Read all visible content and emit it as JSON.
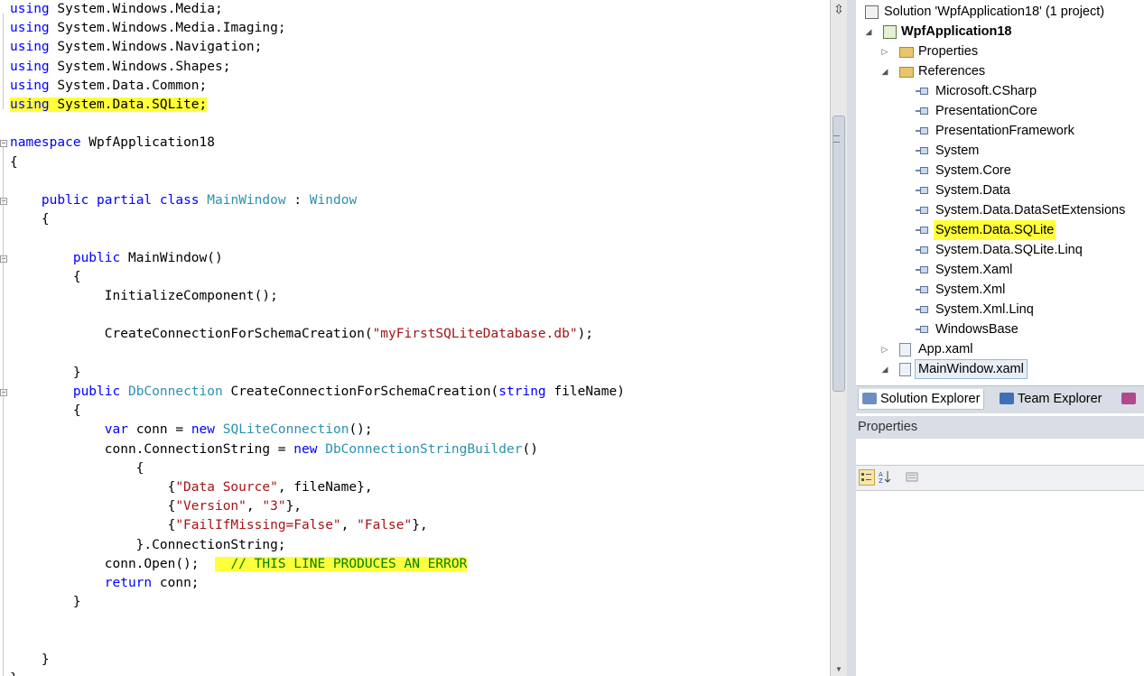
{
  "editor": {
    "lines": [
      {
        "tokens": [
          {
            "t": "using",
            "c": "kw"
          },
          {
            "t": " System.Windows.Media;"
          }
        ]
      },
      {
        "tokens": [
          {
            "t": "using",
            "c": "kw"
          },
          {
            "t": " System.Windows.Media.Imaging;"
          }
        ]
      },
      {
        "tokens": [
          {
            "t": "using",
            "c": "kw"
          },
          {
            "t": " System.Windows.Navigation;"
          }
        ]
      },
      {
        "tokens": [
          {
            "t": "using",
            "c": "kw"
          },
          {
            "t": " System.Windows.Shapes;"
          }
        ]
      },
      {
        "tokens": [
          {
            "t": "using",
            "c": "kw"
          },
          {
            "t": " System.Data.Common;"
          }
        ]
      },
      {
        "tokens": [
          {
            "t": "using",
            "c": "kw hl"
          },
          {
            "t": " System.Data.SQLite;",
            "c": "hl"
          }
        ]
      },
      {
        "tokens": []
      },
      {
        "tokens": [
          {
            "t": "namespace",
            "c": "kw"
          },
          {
            "t": " WpfApplication18"
          }
        ]
      },
      {
        "tokens": [
          {
            "t": "{"
          }
        ]
      },
      {
        "tokens": []
      },
      {
        "tokens": [
          {
            "t": "    "
          },
          {
            "t": "public",
            "c": "kw"
          },
          {
            "t": " "
          },
          {
            "t": "partial",
            "c": "kw"
          },
          {
            "t": " "
          },
          {
            "t": "class",
            "c": "kw"
          },
          {
            "t": " "
          },
          {
            "t": "MainWindow",
            "c": "ty"
          },
          {
            "t": " : "
          },
          {
            "t": "Window",
            "c": "ty"
          }
        ]
      },
      {
        "tokens": [
          {
            "t": "    {"
          }
        ]
      },
      {
        "tokens": []
      },
      {
        "tokens": [
          {
            "t": "        "
          },
          {
            "t": "public",
            "c": "kw"
          },
          {
            "t": " MainWindow()"
          }
        ]
      },
      {
        "tokens": [
          {
            "t": "        {"
          }
        ]
      },
      {
        "tokens": [
          {
            "t": "            InitializeComponent();"
          }
        ]
      },
      {
        "tokens": []
      },
      {
        "tokens": [
          {
            "t": "            CreateConnectionForSchemaCreation("
          },
          {
            "t": "\"myFirstSQLiteDatabase.db\"",
            "c": "str"
          },
          {
            "t": ");"
          }
        ]
      },
      {
        "tokens": []
      },
      {
        "tokens": [
          {
            "t": "        }"
          }
        ]
      },
      {
        "tokens": [
          {
            "t": "        "
          },
          {
            "t": "public",
            "c": "kw"
          },
          {
            "t": " "
          },
          {
            "t": "DbConnection",
            "c": "ty"
          },
          {
            "t": " CreateConnectionForSchemaCreation("
          },
          {
            "t": "string",
            "c": "kw"
          },
          {
            "t": " fileName)"
          }
        ]
      },
      {
        "tokens": [
          {
            "t": "        {"
          }
        ]
      },
      {
        "tokens": [
          {
            "t": "            "
          },
          {
            "t": "var",
            "c": "kw"
          },
          {
            "t": " conn = "
          },
          {
            "t": "new",
            "c": "kw"
          },
          {
            "t": " "
          },
          {
            "t": "SQLiteConnection",
            "c": "ty"
          },
          {
            "t": "();"
          }
        ]
      },
      {
        "tokens": [
          {
            "t": "            conn.ConnectionString = "
          },
          {
            "t": "new",
            "c": "kw"
          },
          {
            "t": " "
          },
          {
            "t": "DbConnectionStringBuilder",
            "c": "ty"
          },
          {
            "t": "()"
          }
        ]
      },
      {
        "tokens": [
          {
            "t": "                {"
          }
        ]
      },
      {
        "tokens": [
          {
            "t": "                    {"
          },
          {
            "t": "\"Data Source\"",
            "c": "str"
          },
          {
            "t": ", fileName},"
          }
        ]
      },
      {
        "tokens": [
          {
            "t": "                    {"
          },
          {
            "t": "\"Version\"",
            "c": "str"
          },
          {
            "t": ", "
          },
          {
            "t": "\"3\"",
            "c": "str"
          },
          {
            "t": "},"
          }
        ]
      },
      {
        "tokens": [
          {
            "t": "                    {"
          },
          {
            "t": "\"FailIfMissing=False\"",
            "c": "str"
          },
          {
            "t": ", "
          },
          {
            "t": "\"False\"",
            "c": "str"
          },
          {
            "t": "},"
          }
        ]
      },
      {
        "tokens": [
          {
            "t": "                }.ConnectionString;"
          }
        ]
      },
      {
        "tokens": [
          {
            "t": "            conn.Open();  "
          },
          {
            "t": "  // THIS LINE PRODUCES AN ERROR",
            "c": "cm hl"
          }
        ]
      },
      {
        "tokens": [
          {
            "t": "            "
          },
          {
            "t": "return",
            "c": "kw"
          },
          {
            "t": " conn;"
          }
        ]
      },
      {
        "tokens": [
          {
            "t": "        }"
          }
        ]
      },
      {
        "tokens": []
      },
      {
        "tokens": []
      },
      {
        "tokens": [
          {
            "t": "    }"
          }
        ]
      },
      {
        "tokens": [
          {
            "t": "}"
          }
        ]
      }
    ]
  },
  "solution_explorer": {
    "items": [
      {
        "label": "Solution 'WpfApplication18' (1 project)",
        "level": 0,
        "toggle": "",
        "icon": "solution-icon",
        "bold": false,
        "highlight": false,
        "selected": false
      },
      {
        "label": "WpfApplication18",
        "level": 1,
        "toggle": "expanded",
        "icon": "csharp-project-icon",
        "bold": true,
        "highlight": false,
        "selected": false
      },
      {
        "label": "Properties",
        "level": 2,
        "toggle": "collapsed",
        "icon": "properties-folder-icon",
        "bold": false,
        "highlight": false,
        "selected": false
      },
      {
        "label": "References",
        "level": 2,
        "toggle": "expanded",
        "icon": "references-folder-icon",
        "bold": false,
        "highlight": false,
        "selected": false
      },
      {
        "label": "Microsoft.CSharp",
        "level": 3,
        "toggle": "",
        "icon": "reference-icon",
        "bold": false,
        "highlight": false,
        "selected": false
      },
      {
        "label": "PresentationCore",
        "level": 3,
        "toggle": "",
        "icon": "reference-icon",
        "bold": false,
        "highlight": false,
        "selected": false
      },
      {
        "label": "PresentationFramework",
        "level": 3,
        "toggle": "",
        "icon": "reference-icon",
        "bold": false,
        "highlight": false,
        "selected": false
      },
      {
        "label": "System",
        "level": 3,
        "toggle": "",
        "icon": "reference-icon",
        "bold": false,
        "highlight": false,
        "selected": false
      },
      {
        "label": "System.Core",
        "level": 3,
        "toggle": "",
        "icon": "reference-icon",
        "bold": false,
        "highlight": false,
        "selected": false
      },
      {
        "label": "System.Data",
        "level": 3,
        "toggle": "",
        "icon": "reference-icon",
        "bold": false,
        "highlight": false,
        "selected": false
      },
      {
        "label": "System.Data.DataSetExtensions",
        "level": 3,
        "toggle": "",
        "icon": "reference-icon",
        "bold": false,
        "highlight": false,
        "selected": false
      },
      {
        "label": "System.Data.SQLite",
        "level": 3,
        "toggle": "",
        "icon": "reference-icon",
        "bold": false,
        "highlight": true,
        "selected": false
      },
      {
        "label": "System.Data.SQLite.Linq",
        "level": 3,
        "toggle": "",
        "icon": "reference-icon",
        "bold": false,
        "highlight": false,
        "selected": false
      },
      {
        "label": "System.Xaml",
        "level": 3,
        "toggle": "",
        "icon": "reference-icon",
        "bold": false,
        "highlight": false,
        "selected": false
      },
      {
        "label": "System.Xml",
        "level": 3,
        "toggle": "",
        "icon": "reference-icon",
        "bold": false,
        "highlight": false,
        "selected": false
      },
      {
        "label": "System.Xml.Linq",
        "level": 3,
        "toggle": "",
        "icon": "reference-icon",
        "bold": false,
        "highlight": false,
        "selected": false
      },
      {
        "label": "WindowsBase",
        "level": 3,
        "toggle": "",
        "icon": "reference-icon",
        "bold": false,
        "highlight": false,
        "selected": false
      },
      {
        "label": "App.xaml",
        "level": 2,
        "toggle": "collapsed",
        "icon": "xaml-file-icon",
        "bold": false,
        "highlight": false,
        "selected": false
      },
      {
        "label": "MainWindow.xaml",
        "level": 2,
        "toggle": "expanded",
        "icon": "xaml-file-icon",
        "bold": false,
        "highlight": false,
        "selected": true
      }
    ]
  },
  "tabs": [
    {
      "label": "Solution Explorer",
      "icon": "solution-explorer-icon",
      "active": true
    },
    {
      "label": "Team Explorer",
      "icon": "team-explorer-icon",
      "active": false
    },
    {
      "label": "",
      "icon": "class-view-icon",
      "active": false
    }
  ],
  "properties": {
    "title": "Properties"
  },
  "colors": {
    "highlight": "#ffff3a",
    "keyword": "#0000ff",
    "type": "#2b91af",
    "string": "#a31515",
    "comment": "#008000"
  }
}
